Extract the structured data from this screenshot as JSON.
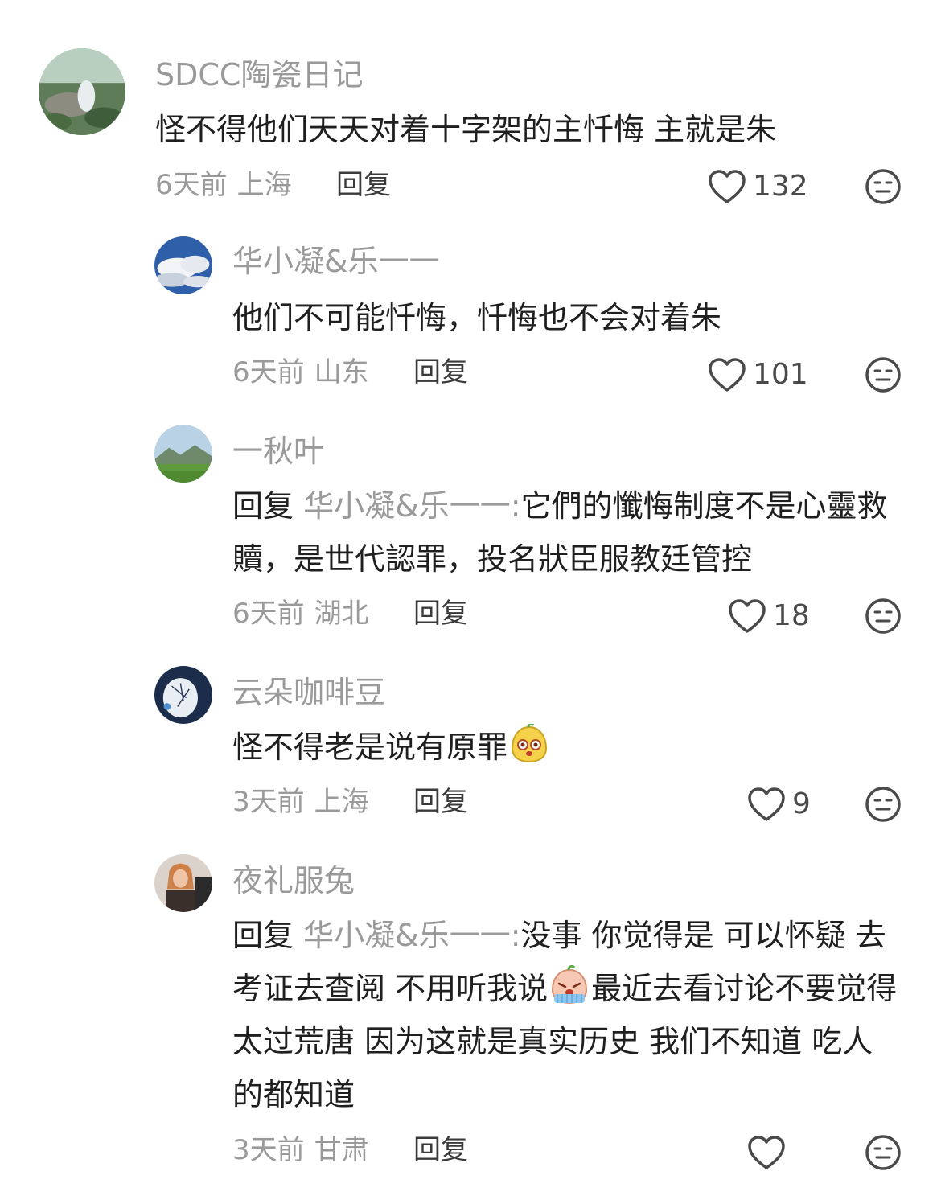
{
  "comments": [
    {
      "username": "SDCC陶瓷日记",
      "text": "怪不得他们天天对着十字架的主忏悔 主就是朱",
      "time": "6天前",
      "location": "上海",
      "reply_label": "回复",
      "likes": "132"
    },
    {
      "username": "华小凝&乐一一",
      "text": "他们不可能忏悔，忏悔也不会对着朱",
      "time": "6天前",
      "location": "山东",
      "reply_label": "回复",
      "likes": "101"
    },
    {
      "username": "一秋叶",
      "reply_prefix": "回复",
      "reply_target": "华小凝&乐一一:",
      "text": "它們的懺悔制度不是心靈救贖，是世代認罪，投名狀臣服教廷管控",
      "time": "6天前",
      "location": "湖北",
      "reply_label": "回复",
      "likes": "18"
    },
    {
      "username": "云朵咖啡豆",
      "text": "怪不得老是说有原罪",
      "emoji": "bean-face-emoji",
      "time": "3天前",
      "location": "上海",
      "reply_label": "回复",
      "likes": "9"
    },
    {
      "username": "夜礼服兔",
      "reply_prefix": "回复",
      "reply_target": "华小凝&乐一一:",
      "text_before_emoji": "没事 你觉得是 可以怀疑 去考证去查阅 不用听我说",
      "emoji": "crying-face-emoji",
      "text_after_emoji": "最近去看讨论不要觉得太过荒唐 因为这就是真实历史 我们不知道 吃人的都知道",
      "time": "3天前",
      "location": "甘肃",
      "reply_label": "回复",
      "likes": ""
    }
  ],
  "icons": {
    "like": "heart-outline-icon",
    "dislike": "meh-face-icon"
  },
  "colors": {
    "secondary_text": "#9a9a9a",
    "primary_text": "#1f1f1f"
  }
}
